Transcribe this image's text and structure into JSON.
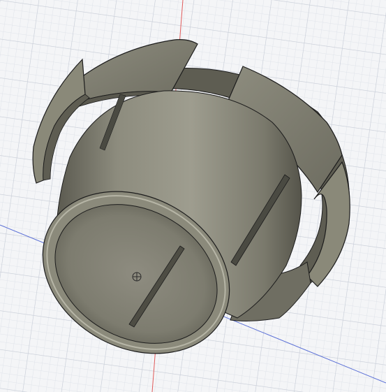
{
  "viewport": {
    "background": "#f4f5f7",
    "grid_minor_color": "#dfe3ea",
    "grid_major_color": "#c9ced8",
    "axis_red": "#e05a5a",
    "axis_blue": "#5a6fd6"
  },
  "model": {
    "name": "cylindrical-sleeve-with-split-flange",
    "body_color": "#787669",
    "body_light": "#a6a597",
    "body_dark": "#55544a",
    "edge_color": "#1c1c1c",
    "origin_icon": "origin-marker-icon"
  }
}
